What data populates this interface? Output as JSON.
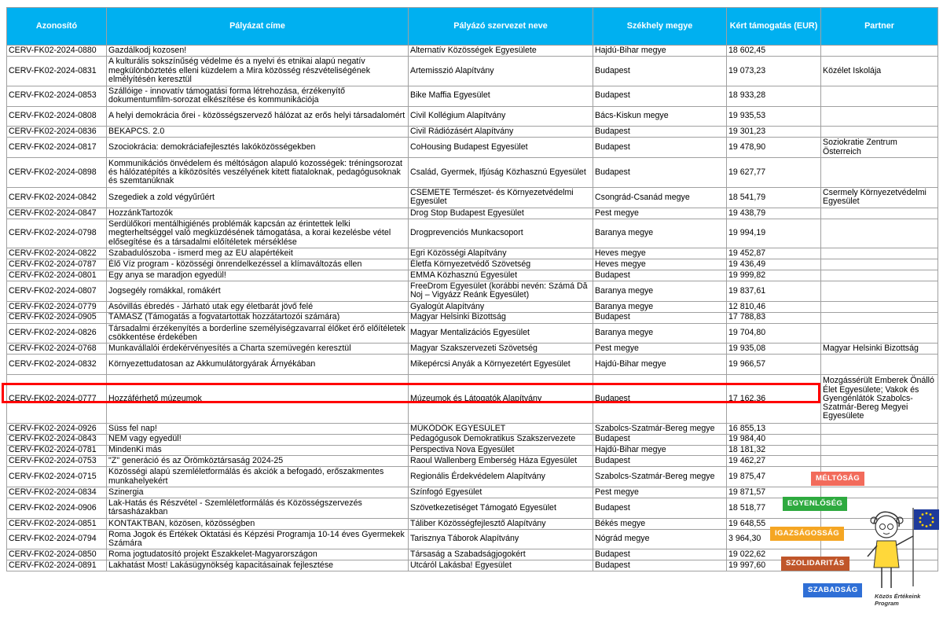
{
  "table": {
    "headers": [
      "Azonosító",
      "Pályázat címe",
      "Pályázó szervezet neve",
      "Székhely megye",
      "Kért támogatás (EUR)",
      "Partner"
    ],
    "rows": [
      [
        "CERV-FK02-2024-0880",
        "Gazdálkodj kozosen!",
        "Alternatív Közösségek Egyesülete",
        "Hajdú-Bihar megye",
        "18 602,45",
        ""
      ],
      [
        "CERV-FK02-2024-0831",
        "A kulturális sokszínűség védelme és a nyelvi és etnikai alapú negatív megkülönböztetés elleni küzdelem a Mira közösség részvételiségének elmélyítésén keresztül",
        "Artemisszió Alapítvány",
        "Budapest",
        "19 073,23",
        "Közélet Iskolája"
      ],
      [
        "CERV-FK02-2024-0853",
        "Szállóige - innovatív támogatási forma létrehozása, érzékenyítő dokumentumfilm-sorozat elkészítése és kommunikációja",
        "Bike Maffia Egyesület",
        "Budapest",
        "18 933,28",
        ""
      ],
      [
        "CERV-FK02-2024-0808",
        "A helyi demokrácia őrei - közösségszervező hálózat az erős helyi társadalomért",
        "Civil Kollégium Alapítvány",
        "Bács-Kiskun megye",
        "19 935,53",
        ""
      ],
      [
        "CERV-FK02-2024-0836",
        "BEKAPCS. 2.0",
        "Civil Rádiózásért Alapítvány",
        "Budapest",
        "19 301,23",
        ""
      ],
      [
        "CERV-FK02-2024-0817",
        "Szociokrácia: demokráciafejlesztés lakóközösségekben",
        "CoHousing Budapest Egyesület",
        "Budapest",
        "19 478,90",
        "Soziokratie Zentrum Österreich"
      ],
      [
        "CERV-FK02-2024-0898",
        "Kommunikációs önvédelem és méltóságon alapuló kozosségek: tréningsorozat és hálózatépítés a kiközösítés veszélyének kitett fiataloknak, pedagógusoknak és szemtanúknak",
        "Család, Gyermek, Ifjúság Közhasznú Egyesület",
        "Budapest",
        "19 627,77",
        ""
      ],
      [
        "CERV-FK02-2024-0842",
        "Szegediek a zold végyűrűért",
        "CSEMETE Természet- és Környezetvédelmi Egyesület",
        "Csongrád-Csanád megye",
        "18 541,79",
        "Csermely Környezetvédelmi Egyesület"
      ],
      [
        "CERV-FK02-2024-0847",
        "HozzánkTartozók",
        "Drog Stop Budapest Egyesület",
        "Pest megye",
        "19 438,79",
        ""
      ],
      [
        "CERV-FK02-2024-0798",
        "Serdülőkori mentálhigiénés problémák kapcsán az érintettek lelki megterheltséggel való megküzdésének támogatása, a korai kezelésbe vétel elősegítése és a társadalmi előítéletek mérséklése",
        "Drogprevenciós Munkacsoport",
        "Baranya megye",
        "19 994,19",
        ""
      ],
      [
        "CERV-FK02-2024-0822",
        "Szabadulószoba - ismerd meg az EU alapértékeit",
        "Egri Közösségi Alapítvány",
        "Heves megye",
        "19 452,87",
        ""
      ],
      [
        "CERV-FK02-2024-0787",
        "Élő Víz program - közösségi önrendelkezéssel a klímaváltozás ellen",
        "Életfa Környezetvédő Szövetség",
        "Heves megye",
        "19 436,49",
        ""
      ],
      [
        "CERV-FK02-2024-0801",
        "Egy anya se maradjon egyedül!",
        "EMMA Közhasznú Egyesület",
        "Budapest",
        "19 999,82",
        ""
      ],
      [
        "CERV-FK02-2024-0807",
        "Jogsegély romákkal, romákért",
        "FreeDrom Egyesület (korábbi nevén: Számá Dă Noj – Vigyázz Reánk Egyesület)",
        "Baranya megye",
        "19 837,61",
        ""
      ],
      [
        "CERV-FK02-2024-0779",
        "Asóvillás ébredés - Járható utak egy életbarát jövő felé",
        "Gyalogút Alapítvány",
        "Baranya megye",
        "12 810,46",
        ""
      ],
      [
        "CERV-FK02-2024-0905",
        "TÁMASZ (Támogatás a fogvatartottak hozzátartozói számára)",
        "Magyar Helsinki Bizottság",
        "Budapest",
        "17 788,83",
        ""
      ],
      [
        "CERV-FK02-2024-0826",
        "Társadalmi érzékenyítés a borderline személyiségzavarral élőket érő előítéletek csökkentése érdekében",
        "Magyar Mentalizációs Egyesület",
        "Baranya megye",
        "19 704,80",
        ""
      ],
      [
        "CERV-FK02-2024-0768",
        "Munkavállalói érdekérvényesítés a Charta szemüvegén keresztül",
        "Magyar Szakszervezeti Szövetség",
        "Pest megye",
        "19 935,08",
        "Magyar Helsinki Bizottság"
      ],
      [
        "CERV-FK02-2024-0832",
        "Környezettudatosan az Akkumulátorgyárak Árnyékában",
        "Mikepércsi Anyák a Környezetért Egyesület",
        "Hajdú-Bihar megye",
        "19 966,57",
        ""
      ],
      [
        "CERV-FK02-2024-0777",
        "Hozzáférhető múzeumok",
        "Múzeumok és Látogatók Alapítvány",
        "Budapest",
        "17 162,36",
        "Mozgássérült Emberek Önálló Élet Egyesülete; Vakok és Gyengénlátók Szabolcs-Szatmár-Bereg Megyei Egyesülete"
      ],
      [
        "CERV-FK02-2024-0926",
        "Süss fel nap!",
        "MŰKÖDŐK EGYESÜLET",
        "Szabolcs-Szatmár-Bereg megye",
        "16 855,13",
        ""
      ],
      [
        "CERV-FK02-2024-0843",
        "NEM vagy egyedül!",
        "Pedagógusok Demokratikus Szakszervezete",
        "Budapest",
        "19 984,40",
        ""
      ],
      [
        "CERV-FK02-2024-0781",
        "MindenKi más",
        "Perspectiva Nova Egyesület",
        "Hajdú-Bihar megye",
        "18 181,32",
        ""
      ],
      [
        "CERV-FK02-2024-0753",
        "\"Z\" generáció és az Örömköztársaság 2024-25",
        "Raoul Wallenberg Emberség Háza Egyesület",
        "Budapest",
        "19 462,27",
        ""
      ],
      [
        "CERV-FK02-2024-0715",
        "Közösségi alapú szemléletformálás és akciók a befogadó, erőszakmentes munkahelyekért",
        "Regionális Érdekvédelem Alapítvány",
        "Szabolcs-Szatmár-Bereg megye",
        "19 875,47",
        ""
      ],
      [
        "CERV-FK02-2024-0834",
        "Szinergia",
        "Színfogó Egyesület",
        "Pest megye",
        "19 871,57",
        ""
      ],
      [
        "CERV-FK02-2024-0906",
        "Lak-Hatás és Részvétel - Szemléletformálás és Közösségszervezés társasházakban",
        "Szövetkezetiséget Támogató Egyesület",
        "Budapest",
        "18 518,77",
        ""
      ],
      [
        "CERV-FK02-2024-0851",
        "KONTAKTBAN, közösen, közösségben",
        "Táliber Közösségfejlesztő Alapítvány",
        "Békés megye",
        "19 648,55",
        ""
      ],
      [
        "CERV-FK02-2024-0794",
        "Roma Jogok és Értékek Oktatási és Képzési Programja 10-14 éves Gyermekek Számára",
        "Tarisznya Táborok Alapítvány",
        "Nógrád megye",
        "3 964,30",
        ""
      ],
      [
        "CERV-FK02-2024-0850",
        "Roma jogtudatosító projekt Északkelet-Magyarországon",
        "Társaság a Szabadságjogokért",
        "Budapest",
        "19 022,62",
        ""
      ],
      [
        "CERV-FK02-2024-0891",
        "Lakhatást Most! Lakásügynökség kapacitásainak fejlesztése",
        "Utcáról Lakásba! Egyesület",
        "Budapest",
        "19 997,60",
        ""
      ]
    ]
  },
  "overlay": {
    "tags": [
      "MÉLTÓSÁG",
      "EGYENLŐSÉG",
      "IGAZSÁGOSSÁG",
      "SZOLIDARITÁS",
      "SZABADSÁG"
    ],
    "tag_colors": [
      "#f26b5b",
      "#2eaa3f",
      "#f5a623",
      "#c0562a",
      "#2f6fd6"
    ],
    "program_name": "Közös Értékeink Program",
    "highlight_color": "#ff0000",
    "header_color": "#00b0f0"
  }
}
